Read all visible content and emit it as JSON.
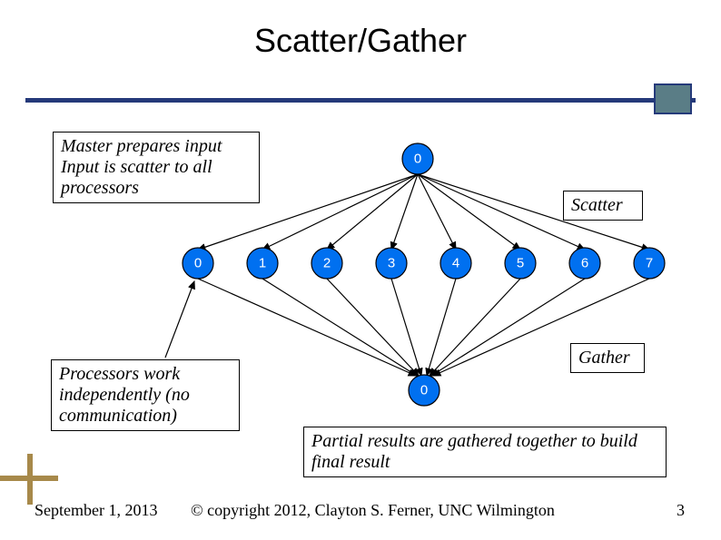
{
  "title": "Scatter/Gather",
  "boxes": {
    "master": "Master prepares input\nInput is scatter to all processors",
    "proc": "Processors work independently (no communication)",
    "partial": "Partial results are gathered together to build final result"
  },
  "labels": {
    "scatter": "Scatter",
    "gather": "Gather"
  },
  "nodes": {
    "top": "0",
    "row": [
      "0",
      "1",
      "2",
      "3",
      "4",
      "5",
      "6",
      "7"
    ],
    "bottom": "0"
  },
  "footer": {
    "date": "September 1, 2013",
    "copyright": "© copyright 2012, Clayton S. Ferner, UNC Wilmington",
    "page": "3"
  },
  "chart_data": {
    "type": "diagram",
    "pattern": "scatter-gather",
    "root_label": "0",
    "worker_labels": [
      "0",
      "1",
      "2",
      "3",
      "4",
      "5",
      "6",
      "7"
    ],
    "gather_label": "0",
    "annotations": [
      "Scatter",
      "Gather"
    ]
  }
}
